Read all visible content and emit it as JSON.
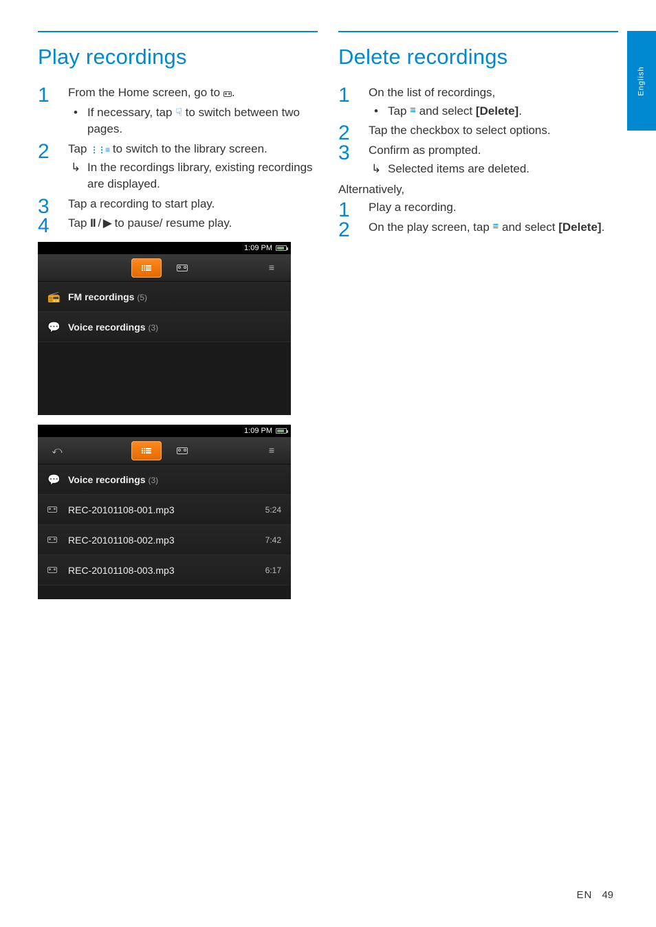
{
  "lang_tab": "English",
  "footer": {
    "lang": "EN",
    "page": "49"
  },
  "col1": {
    "title": "Play recordings",
    "steps": [
      {
        "text_a": "From the Home screen, go to ",
        "text_b": ".",
        "sub_bullets": [
          {
            "a": "If necessary, tap ",
            "b": " to switch between two pages."
          }
        ]
      },
      {
        "text_a": "Tap ",
        "text_b": " to switch to the library screen.",
        "result": "In the recordings library, existing recordings are displayed."
      },
      {
        "text_a": "Tap a recording to start play."
      },
      {
        "text_a": "Tap ",
        "text_b": " to pause/ resume play."
      }
    ],
    "screenshot1": {
      "time": "1:09 PM",
      "rows": [
        {
          "icon": "radio",
          "label": "FM recordings",
          "count": "(5)"
        },
        {
          "icon": "voice",
          "label": "Voice recordings",
          "count": "(3)"
        }
      ]
    },
    "screenshot2": {
      "time": "1:09 PM",
      "header_row": {
        "icon": "voice",
        "label": "Voice recordings",
        "count": "(3)"
      },
      "files": [
        {
          "name": "REC-20101108-001.mp3",
          "dur": "5:24"
        },
        {
          "name": "REC-20101108-002.mp3",
          "dur": "7:42"
        },
        {
          "name": "REC-20101108-003.mp3",
          "dur": "6:17"
        }
      ]
    }
  },
  "col2": {
    "title": "Delete recordings",
    "steps": [
      {
        "text_a": "On the list of recordings,",
        "sub_bullets": [
          {
            "a": "Tap ",
            "b": " and select ",
            "c": "[Delete]",
            "d": "."
          }
        ]
      },
      {
        "text_a": "Tap the checkbox to select options."
      },
      {
        "text_a": "Confirm as prompted.",
        "result": "Selected items are deleted."
      }
    ],
    "alt_label": "Alternatively,",
    "alt_steps": [
      {
        "text_a": "Play a recording."
      },
      {
        "text_a": "On the play screen, tap ",
        "text_b": " and select ",
        "bold": "[Delete]",
        "text_c": "."
      }
    ]
  }
}
